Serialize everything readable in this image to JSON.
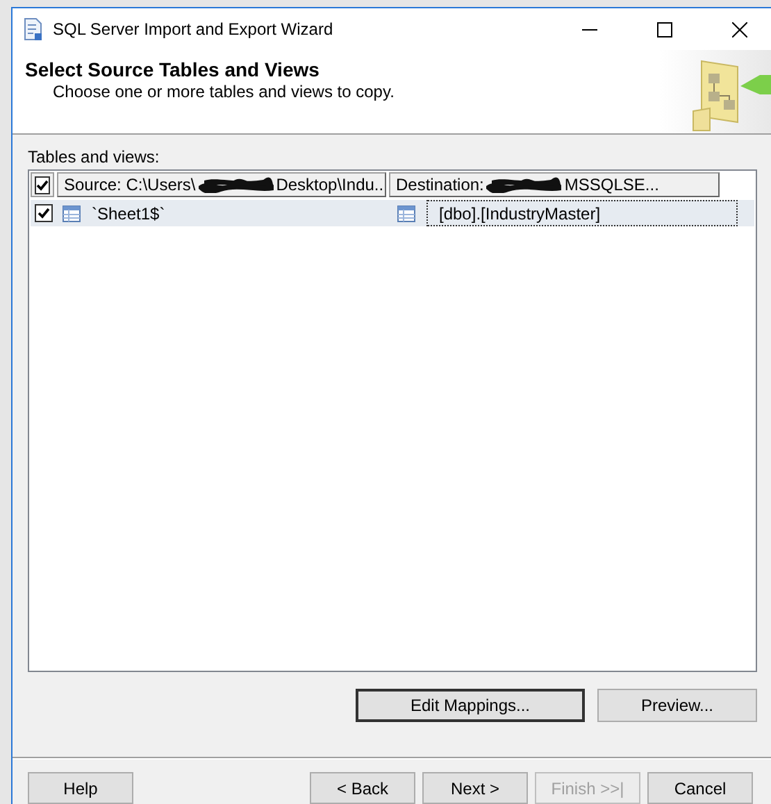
{
  "window": {
    "title": "SQL Server Import and Export Wizard"
  },
  "header": {
    "title": "Select Source Tables and Views",
    "subtitle": "Choose one or more tables and views to copy."
  },
  "table": {
    "label": "Tables and views:",
    "all_checked": true,
    "columns": [
      {
        "before": "Source: C:\\Users\\",
        "redacted": true,
        "after": "Desktop\\Indu..."
      },
      {
        "before": "Destination: ",
        "redacted": true,
        "after": "MSSQLSE..."
      }
    ],
    "rows": [
      {
        "checked": true,
        "selected": true,
        "source": "`Sheet1$`",
        "destination": "[dbo].[IndustryMaster]"
      }
    ]
  },
  "actions": [
    {
      "label": "Edit Mappings...",
      "default": true
    },
    {
      "label": "Preview...",
      "default": false
    }
  ],
  "help_button": {
    "label": "Help",
    "disabled": false
  },
  "nav_buttons": [
    {
      "label": "< Back",
      "disabled": false
    },
    {
      "label": "Next >",
      "disabled": false
    },
    {
      "label": "Finish >>|",
      "disabled": true
    },
    {
      "label": "Cancel",
      "disabled": false
    }
  ]
}
